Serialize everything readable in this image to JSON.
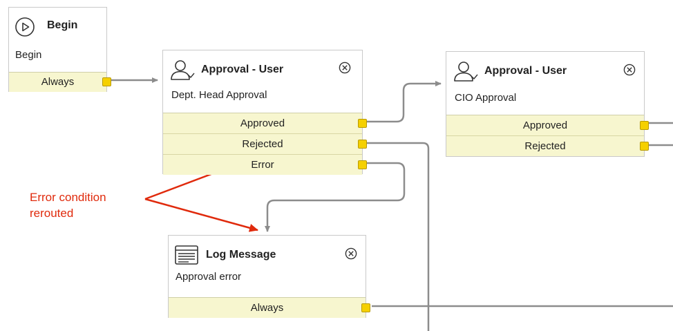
{
  "nodes": {
    "begin": {
      "title": "Begin",
      "description": "Begin",
      "icon": "play-circle-icon",
      "outputs": [
        "Always"
      ]
    },
    "dept_approval": {
      "title": "Approval - User",
      "description": "Dept. Head Approval",
      "icon": "user-approval-icon",
      "outputs": [
        "Approved",
        "Rejected",
        "Error"
      ]
    },
    "cio_approval": {
      "title": "Approval - User",
      "description": "CIO Approval",
      "icon": "user-approval-icon",
      "outputs": [
        "Approved",
        "Rejected"
      ]
    },
    "log_message": {
      "title": "Log Message",
      "description": "Approval error",
      "icon": "log-message-icon",
      "outputs": [
        "Always"
      ]
    }
  },
  "annotation": {
    "line1": "Error condition",
    "line2": "rerouted",
    "color": "#e02a0c"
  },
  "colors": {
    "port": "#f5d000",
    "output_row": "#f7f6cf",
    "connector": "#8c8c8c"
  }
}
